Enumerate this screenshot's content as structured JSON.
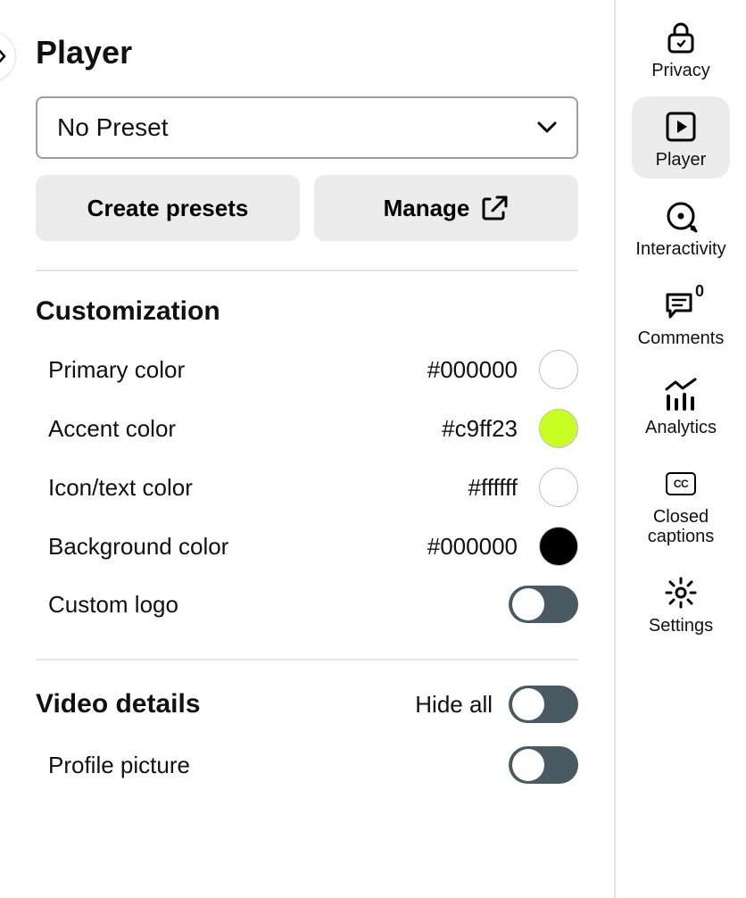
{
  "page": {
    "title": "Player"
  },
  "preset": {
    "selected": "No Preset",
    "create_label": "Create presets",
    "manage_label": "Manage"
  },
  "customization": {
    "title": "Customization",
    "primary": {
      "label": "Primary color",
      "value": "#000000",
      "swatch": "#000000"
    },
    "accent": {
      "label": "Accent color",
      "value": "#c9ff23",
      "swatch": "#c9ff23"
    },
    "icontext": {
      "label": "Icon/text color",
      "value": "#ffffff",
      "swatch": "#ffffff"
    },
    "background": {
      "label": "Background color",
      "value": "#000000",
      "swatch": "#000000"
    },
    "custom_logo": {
      "label": "Custom logo",
      "enabled": false
    }
  },
  "video_details": {
    "title": "Video details",
    "hide_all_label": "Hide all",
    "hide_all_enabled": false,
    "profile_picture": {
      "label": "Profile picture",
      "enabled": false
    }
  },
  "sidebar": {
    "privacy": "Privacy",
    "player": "Player",
    "interactivity": "Interactivity",
    "comments": "Comments",
    "comments_count": "0",
    "analytics": "Analytics",
    "cc_glyph": "CC",
    "closed_captions": "Closed captions",
    "settings": "Settings"
  }
}
